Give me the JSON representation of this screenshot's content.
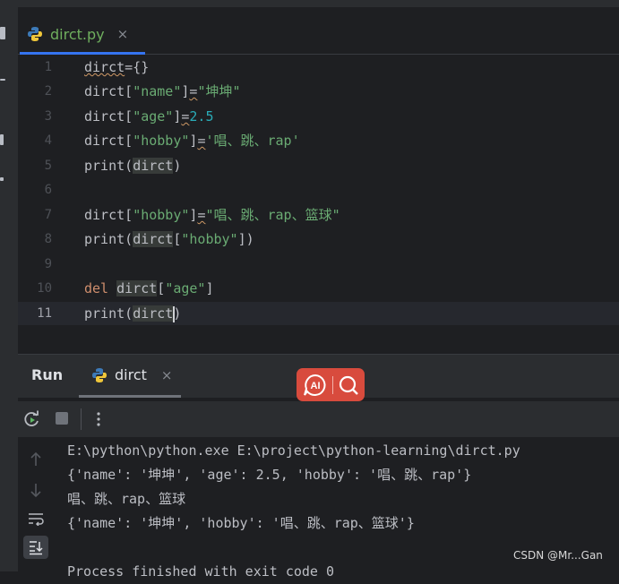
{
  "editor_tab": {
    "filename": "dirct.py",
    "close_glyph": "×"
  },
  "line_numbers": [
    "1",
    "2",
    "3",
    "4",
    "5",
    "6",
    "7",
    "8",
    "9",
    "10",
    "11"
  ],
  "code": {
    "l1": {
      "var": "dirct",
      "rest": "={}"
    },
    "l2": {
      "var": "dirct",
      "b1": "[",
      "key": "\"name\"",
      "b2": "]",
      "eq": "=",
      "val": "\"坤坤\""
    },
    "l3": {
      "var": "dirct",
      "b1": "[",
      "key": "\"age\"",
      "b2": "]",
      "eq": "=",
      "val": "2.5"
    },
    "l4": {
      "var": "dirct",
      "b1": "[",
      "key": "\"hobby\"",
      "b2": "]",
      "eq": "=",
      "val": "'唱、跳、rap'"
    },
    "l5": {
      "fn": "print",
      "p1": "(",
      "arg": "dirct",
      "p2": ")"
    },
    "l7": {
      "var": "dirct",
      "b1": "[",
      "key": "\"hobby\"",
      "b2": "]",
      "eq": "=",
      "val": "\"唱、跳、rap、篮球\""
    },
    "l8": {
      "fn": "print",
      "p1": "(",
      "arg": "dirct",
      "b1": "[",
      "key": "\"hobby\"",
      "b2": "])"
    },
    "l10": {
      "kw": "del",
      "sp": " ",
      "var": "dirct",
      "b1": "[",
      "key": "\"age\"",
      "b2": "]"
    },
    "l11": {
      "fn": "print",
      "p1": "(",
      "arg": "dirct",
      "p2": ")"
    }
  },
  "run_panel": {
    "title": "Run",
    "tab_name": "dirct",
    "close_glyph": "×"
  },
  "console_lines": [
    "E:\\python\\python.exe E:\\project\\python-learning\\dirct.py",
    "{'name': '坤坤', 'age': 2.5, 'hobby': '唱、跳、rap'}",
    "唱、跳、rap、篮球",
    "{'name': '坤坤', 'hobby': '唱、跳、rap、篮球'}",
    "Process finished with exit code 0"
  ],
  "overlay_badge": {
    "ai_text": "AI"
  },
  "watermark": "CSDN @Mr...Gan",
  "icons": [
    "python-file-icon",
    "rerun-icon",
    "stop-icon",
    "more-vert-icon",
    "arrow-up-icon",
    "arrow-down-icon",
    "soft-wrap-icon",
    "scroll-to-end-icon",
    "ai-icon",
    "search-icon"
  ],
  "colors": {
    "accent": "#3574f0",
    "string": "#6aab73",
    "number": "#2aacb8",
    "keyword": "#cf8e6d",
    "badge": "#d84b3d"
  }
}
